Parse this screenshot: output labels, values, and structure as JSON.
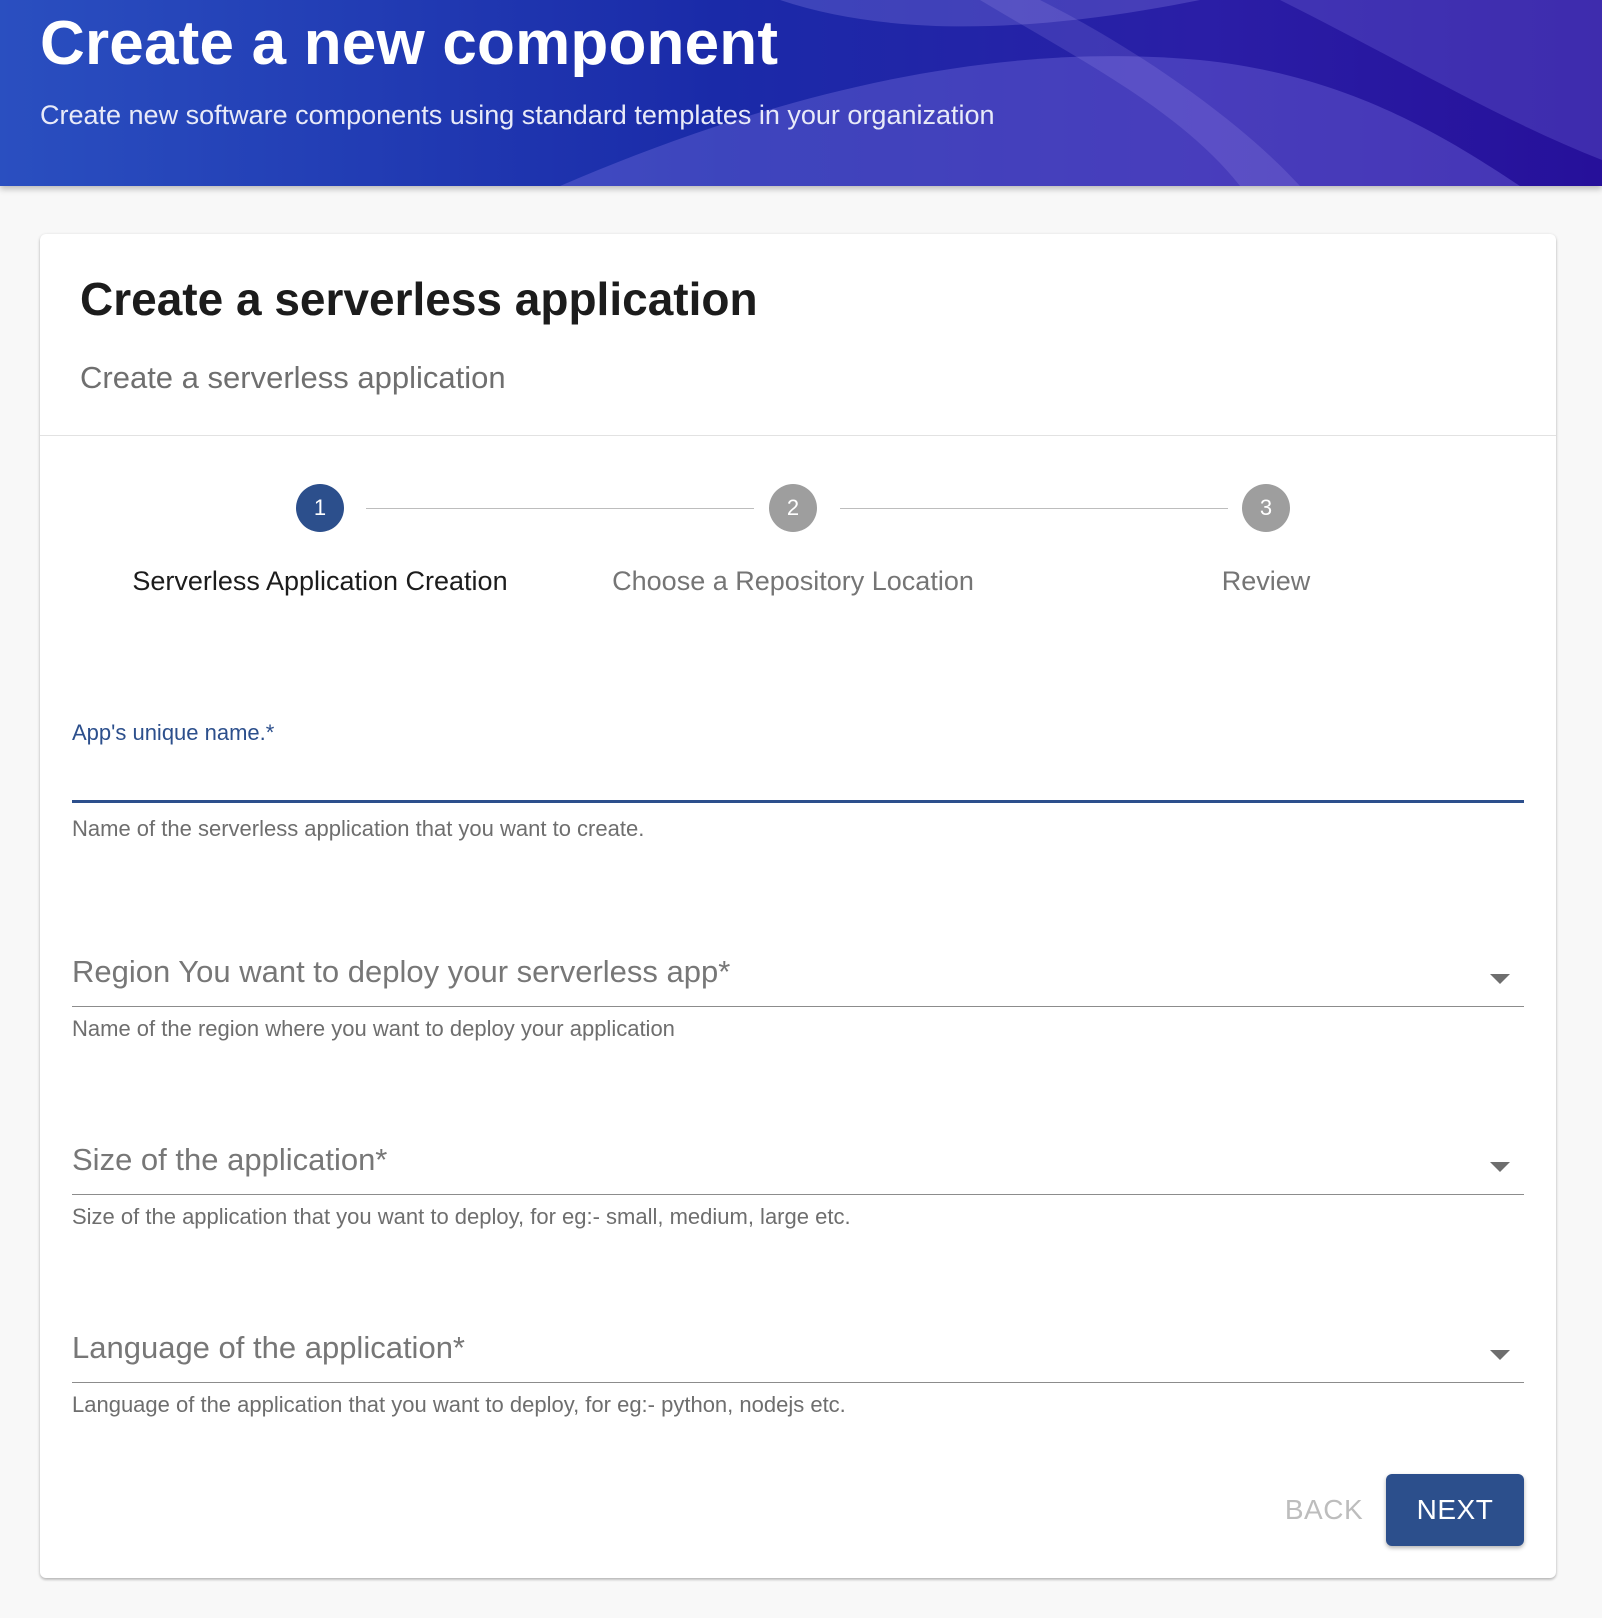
{
  "header": {
    "title": "Create a new component",
    "subtitle": "Create new software components using standard templates in your organization"
  },
  "template": {
    "title": "Create a serverless application",
    "subtitle": "Create a serverless application"
  },
  "stepper": {
    "steps": [
      {
        "number": "1",
        "label": "Serverless Application Creation",
        "state": "active"
      },
      {
        "number": "2",
        "label": "Choose a Repository Location",
        "state": "inactive"
      },
      {
        "number": "3",
        "label": "Review",
        "state": "inactive"
      }
    ]
  },
  "form": {
    "app_name": {
      "label": "App's unique name.*",
      "value": "",
      "helper": "Name of the serverless application that you want to create."
    },
    "region": {
      "label": "Region You want to deploy your serverless app*",
      "helper": "Name of the region where you want to deploy your application"
    },
    "size": {
      "label": "Size of the application*",
      "helper": "Size of the application that you want to deploy, for eg:- small, medium, large etc."
    },
    "language": {
      "label": "Language of the application*",
      "helper": "Language of the application that you want to deploy, for eg:- python, nodejs etc."
    }
  },
  "actions": {
    "back_label": "BACK",
    "next_label": "NEXT"
  },
  "colors": {
    "primary": "#2c4f8c",
    "step_inactive": "#9e9e9e",
    "header_gradient_start": "#2a4fc0",
    "header_gradient_end": "#26109a"
  },
  "icons": {
    "select_caret": "chevron-down-icon"
  }
}
